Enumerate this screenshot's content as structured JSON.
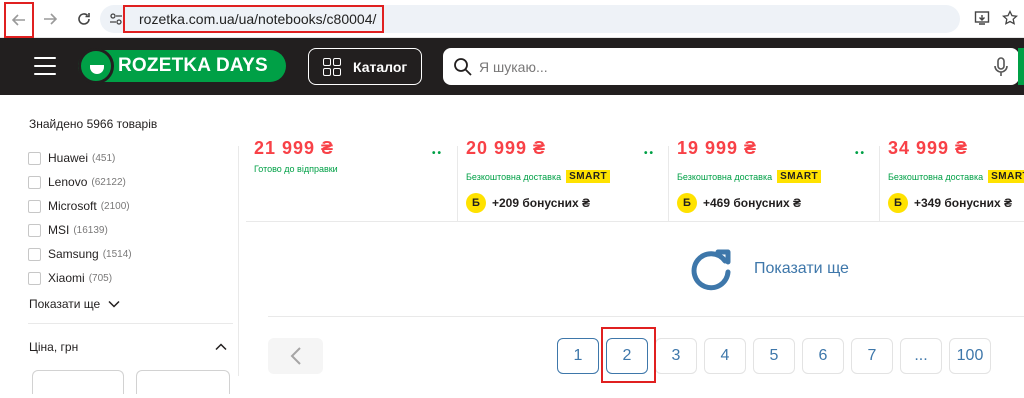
{
  "browser": {
    "url": "rozetka.com.ua/ua/notebooks/c80004/"
  },
  "header": {
    "logo_text": "ROZETKA DAYS",
    "catalog_label": "Каталог",
    "search_placeholder": "Я шукаю..."
  },
  "sidebar": {
    "found_text": "Знайдено 5966 товарів",
    "brands": [
      {
        "name": "Huawei",
        "count": "(451)"
      },
      {
        "name": "Lenovo",
        "count": "(62122)"
      },
      {
        "name": "Microsoft",
        "count": "(2100)"
      },
      {
        "name": "MSI",
        "count": "(16139)"
      },
      {
        "name": "Samsung",
        "count": "(1514)"
      },
      {
        "name": "Xiaomi",
        "count": "(705)"
      }
    ],
    "show_more": "Показати ще",
    "price_title": "Ціна, грн"
  },
  "products": [
    {
      "price": "21 999 ₴",
      "status": "Готово до відправки"
    },
    {
      "price": "20 999 ₴",
      "delivery": "Безкоштовна доставка",
      "smart": "SMART",
      "bonus": "+209 бонусних ₴"
    },
    {
      "price": "19 999 ₴",
      "delivery": "Безкоштовна доставка",
      "smart": "SMART",
      "bonus": "+469 бонусних ₴"
    },
    {
      "price": "34 999 ₴",
      "delivery": "Безкоштовна доставка",
      "smart": "SMART",
      "bonus": "+349 бонусних ₴"
    }
  ],
  "bonus_badge": "Б",
  "show_more_products": "Показати ще",
  "pagination": {
    "pages": [
      "1",
      "2",
      "3",
      "4",
      "5",
      "6",
      "7",
      "...",
      "100"
    ],
    "current": "2"
  },
  "colors": {
    "brand_green": "#00a046",
    "header_bg": "#221f1f",
    "price_red": "#f84147",
    "link_blue": "#3e77aa",
    "highlight_red": "#e02020"
  }
}
